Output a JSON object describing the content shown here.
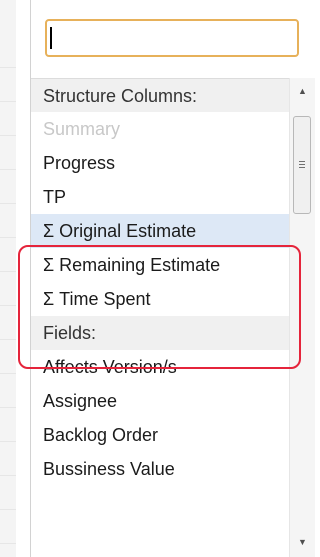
{
  "search": {
    "value": "",
    "placeholder": ""
  },
  "dropdown": {
    "sections": [
      {
        "header": "Structure Columns:",
        "items": [
          {
            "label": "Summary",
            "state": "disabled"
          },
          {
            "label": "Progress",
            "state": "normal"
          },
          {
            "label": "TP",
            "state": "normal"
          },
          {
            "label": "Σ Original Estimate",
            "state": "selected"
          },
          {
            "label": "Σ Remaining Estimate",
            "state": "normal"
          },
          {
            "label": "Σ Time Spent",
            "state": "normal"
          }
        ]
      },
      {
        "header": "Fields:",
        "items": [
          {
            "label": "Affects Version/s",
            "state": "normal"
          },
          {
            "label": "Assignee",
            "state": "normal"
          },
          {
            "label": "Backlog Order",
            "state": "normal"
          },
          {
            "label": "Bussiness Value",
            "state": "normal"
          }
        ]
      }
    ]
  },
  "scrollbar": {
    "up_icon": "scroll-up-arrow",
    "down_icon": "scroll-down-arrow",
    "position": 0.1
  },
  "colors": {
    "search_border": "#e7b15a",
    "highlight_border": "#e5243b",
    "selected_row": "#dde8f6",
    "disabled_text": "#c8c8c8",
    "section_header_bg": "#f0f0f0"
  }
}
